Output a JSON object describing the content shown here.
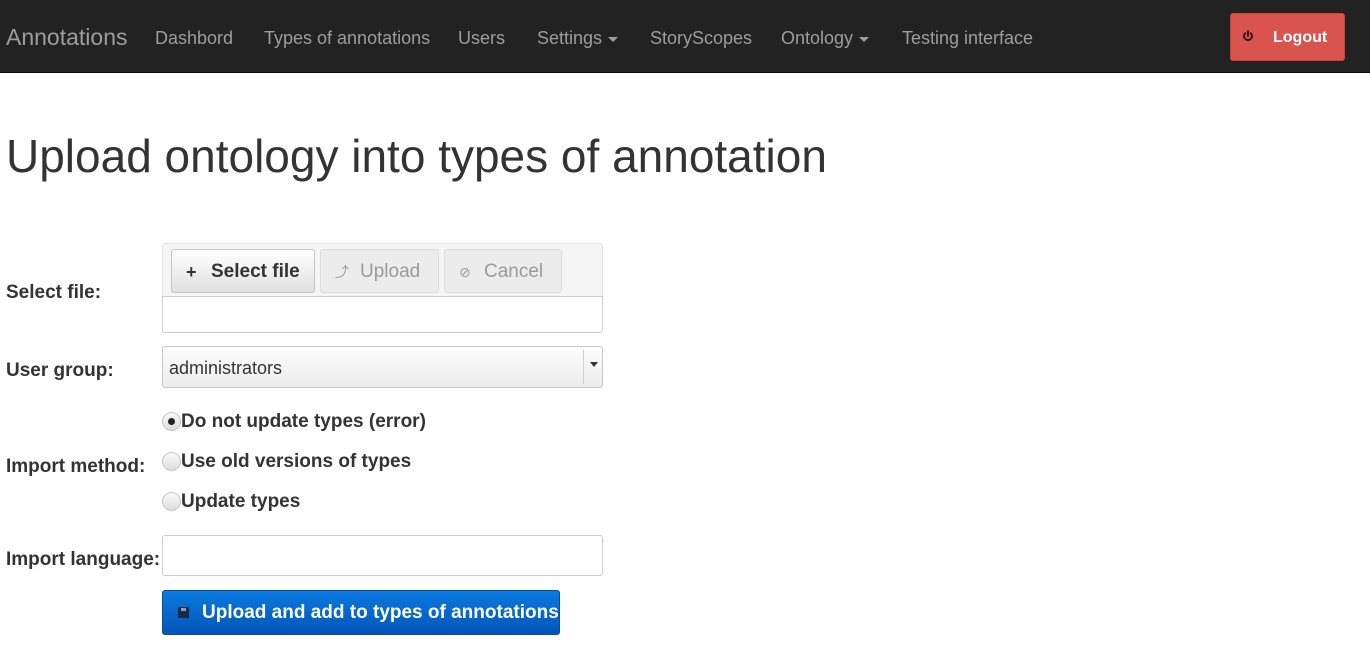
{
  "navbar": {
    "brand": "Annotations",
    "items": [
      {
        "label": "Dashbord",
        "dropdown": false
      },
      {
        "label": "Types of annotations",
        "dropdown": false
      },
      {
        "label": "Users",
        "dropdown": false
      },
      {
        "label": "Settings",
        "dropdown": true
      },
      {
        "label": "StoryScopes",
        "dropdown": false
      },
      {
        "label": "Ontology",
        "dropdown": true
      },
      {
        "label": "Testing interface",
        "dropdown": false
      }
    ],
    "logout_label": "Logout"
  },
  "page": {
    "title": "Upload ontology into types of annotation"
  },
  "form": {
    "select_file_label": "Select file:",
    "file_buttons": {
      "select": "Select file",
      "upload": "Upload",
      "cancel": "Cancel"
    },
    "user_group_label": "User group:",
    "user_group_value": "administrators",
    "import_method_label": "Import method:",
    "import_methods": [
      {
        "label": "Do not update types (error)",
        "checked": true
      },
      {
        "label": "Use old versions of types",
        "checked": false
      },
      {
        "label": "Update types",
        "checked": false
      }
    ],
    "import_language_label": "Import language:",
    "import_language_value": "",
    "submit_label": "Upload and add to types of annotations"
  },
  "colors": {
    "navbar_bg": "#222222",
    "logout_bg": "#d9534f",
    "submit_bg": "#0a6fd6"
  }
}
